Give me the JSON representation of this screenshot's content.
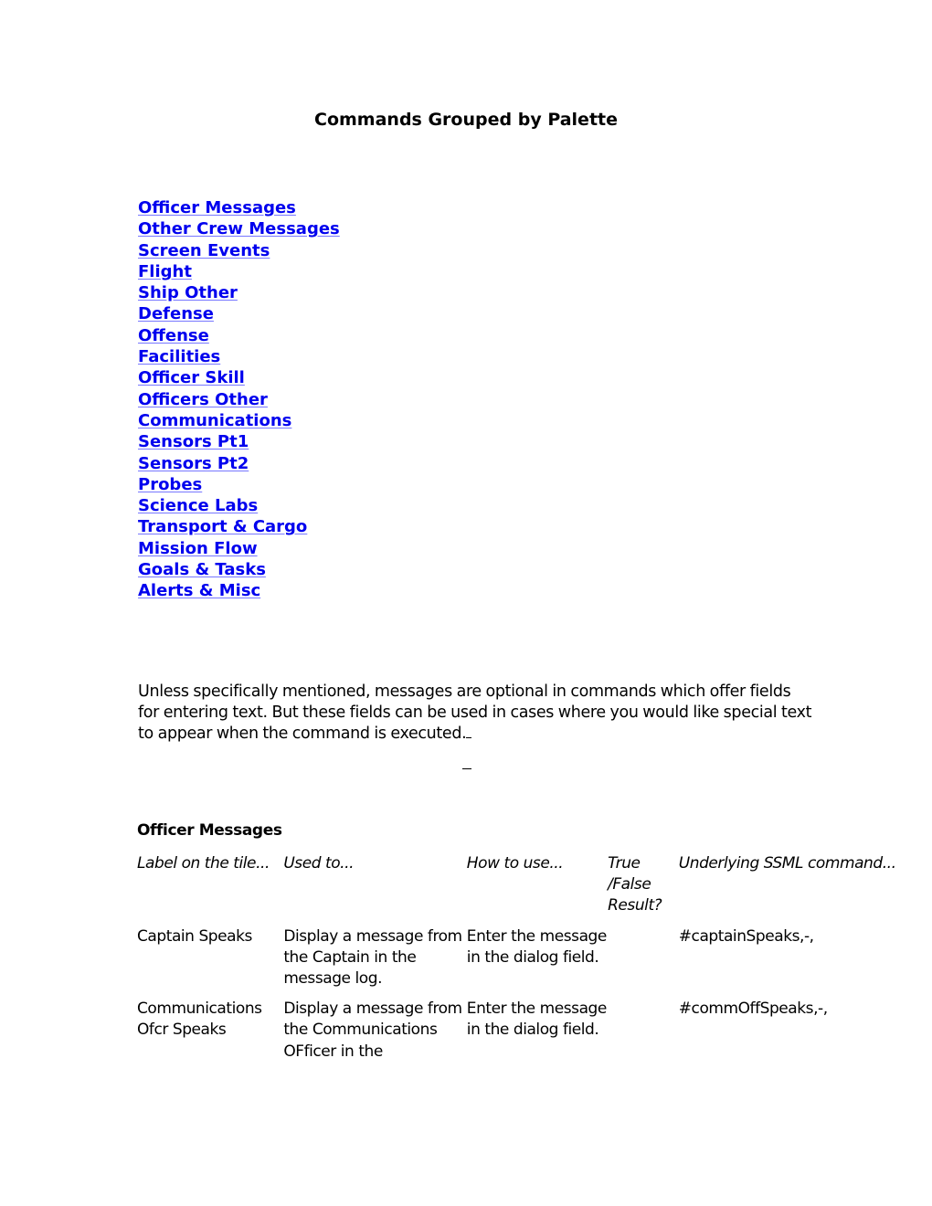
{
  "document": {
    "title": "Commands Grouped by Palette",
    "toc": [
      "Officer Messages",
      "Other Crew Messages",
      "Screen Events",
      "Flight",
      "Ship Other",
      "Defense",
      "Offense",
      "Facilities",
      "Officer Skill",
      "Officers Other",
      "Communications",
      "Sensors Pt1",
      "Sensors Pt2",
      "Probes",
      "Science Labs",
      "Transport & Cargo",
      "Mission Flow",
      "Goals & Tasks",
      "Alerts & Misc"
    ],
    "intro": "Unless specifically mentioned, messages are optional in commands which offer fields for entering text. But these fields can be used in cases where you would like special text to appear when the command is executed.",
    "section": {
      "heading": "Officer Messages",
      "columns": [
        "Label on the tile...",
        "Used to...",
        "How to use...",
        "True /False Result?",
        "Underlying SSML command..."
      ],
      "rows": [
        {
          "label": "Captain Speaks",
          "used_to": "Display a message from the Captain in the message log.",
          "how_to_use": "Enter the message in the dialog field.",
          "result": "",
          "command": "#captainSpeaks,-,"
        },
        {
          "label": "Communications Ofcr Speaks",
          "used_to": "Display a message from the Communications OFficer in the",
          "how_to_use": "Enter the message in the dialog field.",
          "result": "",
          "command": "#commOffSpeaks,-,"
        }
      ]
    }
  }
}
